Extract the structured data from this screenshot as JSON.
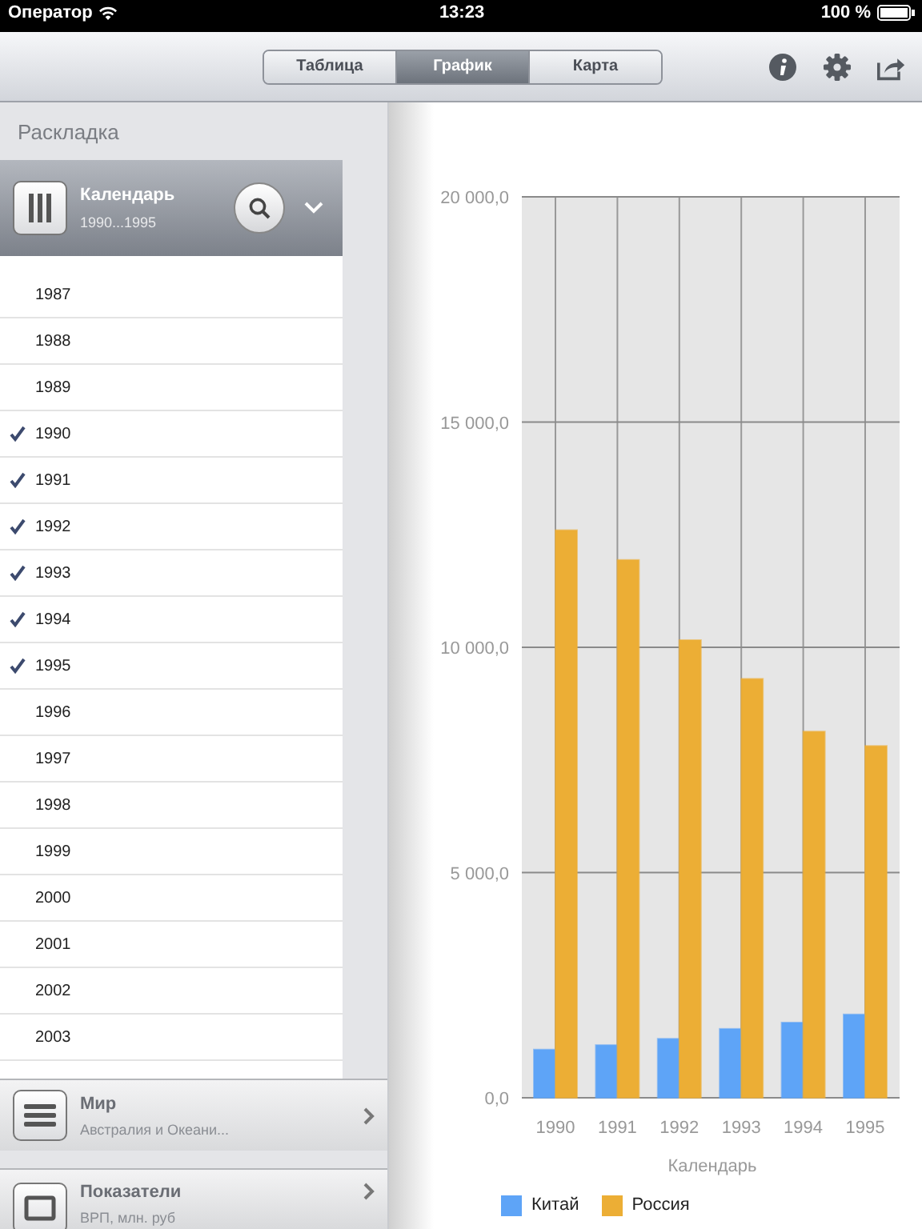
{
  "status_bar": {
    "carrier": "Оператор",
    "time": "13:23",
    "battery": "100 %"
  },
  "toolbar": {
    "segments": [
      {
        "label": "Таблица",
        "selected": false
      },
      {
        "label": "График",
        "selected": true
      },
      {
        "label": "Карта",
        "selected": false
      }
    ]
  },
  "sidebar": {
    "title": "Раскладка",
    "dimension": {
      "name": "Календарь",
      "summary": "1990...1995"
    },
    "items": [
      {
        "label": "1987",
        "checked": false
      },
      {
        "label": "1988",
        "checked": false
      },
      {
        "label": "1989",
        "checked": false
      },
      {
        "label": "1990",
        "checked": true
      },
      {
        "label": "1991",
        "checked": true
      },
      {
        "label": "1992",
        "checked": true
      },
      {
        "label": "1993",
        "checked": true
      },
      {
        "label": "1994",
        "checked": true
      },
      {
        "label": "1995",
        "checked": true
      },
      {
        "label": "1996",
        "checked": false
      },
      {
        "label": "1997",
        "checked": false
      },
      {
        "label": "1998",
        "checked": false
      },
      {
        "label": "1999",
        "checked": false
      },
      {
        "label": "2000",
        "checked": false
      },
      {
        "label": "2001",
        "checked": false
      },
      {
        "label": "2002",
        "checked": false
      },
      {
        "label": "2003",
        "checked": false
      }
    ],
    "panels": [
      {
        "kind": "list",
        "name": "Мир",
        "summary": "Австралия и Океани..."
      },
      {
        "kind": "single",
        "name": "Показатели",
        "summary": "ВРП, млн. руб"
      }
    ]
  },
  "chart": {
    "chart_data": {
      "type": "bar",
      "xlabel": "Календарь",
      "categories": [
        "1990",
        "1991",
        "1992",
        "1993",
        "1994",
        "1995"
      ],
      "series": [
        {
          "name": "Китай",
          "color": "#5ea4f7",
          "values": [
            1070,
            1170,
            1310,
            1530,
            1670,
            1850
          ]
        },
        {
          "name": "Россия",
          "color": "#ecae35",
          "values": [
            12600,
            11940,
            10160,
            9300,
            8130,
            7810
          ]
        }
      ],
      "ylim": [
        0,
        20000
      ],
      "grid": true,
      "yticks": [
        {
          "value": 0,
          "label": "0,0"
        },
        {
          "value": 5000,
          "label": "5 000,0"
        },
        {
          "value": 10000,
          "label": "10 000,0"
        },
        {
          "value": 15000,
          "label": "15 000,0"
        },
        {
          "value": 20000,
          "label": "20 000,0"
        }
      ]
    }
  }
}
